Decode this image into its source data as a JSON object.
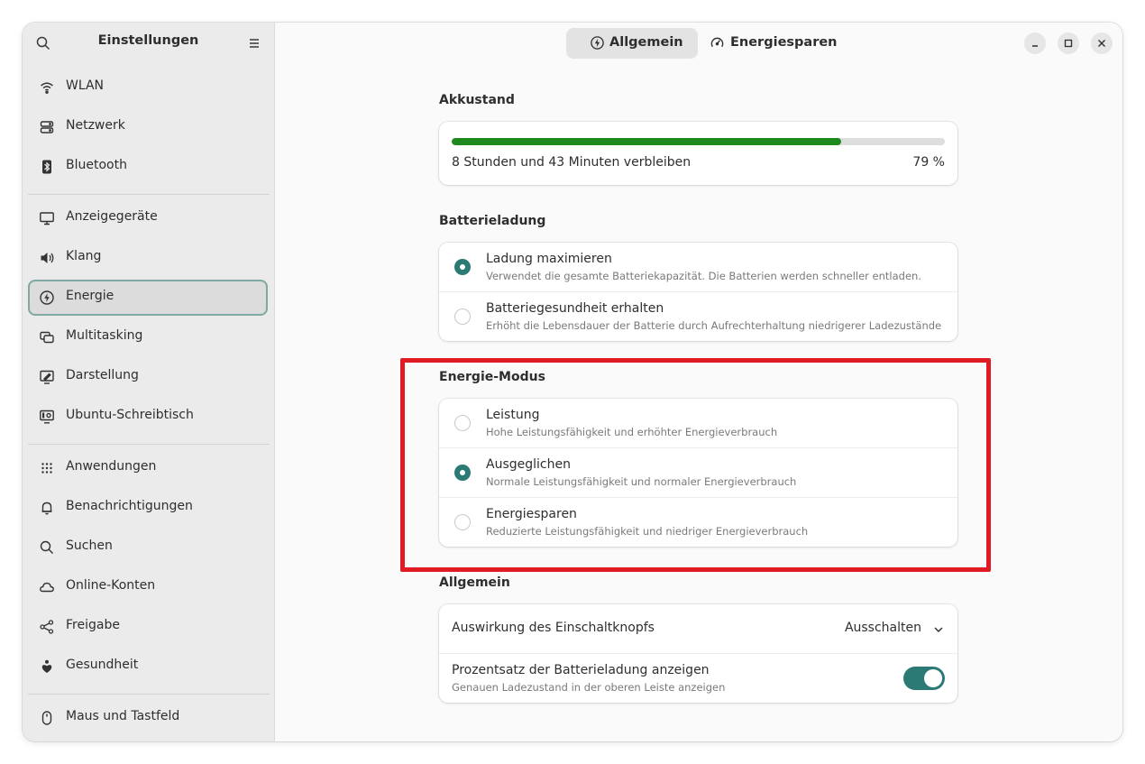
{
  "sidebar": {
    "title": "Einstellungen",
    "items": [
      {
        "label": "WLAN",
        "icon": "wifi-icon"
      },
      {
        "label": "Netzwerk",
        "icon": "network-icon"
      },
      {
        "label": "Bluetooth",
        "icon": "bluetooth-icon"
      },
      {
        "label": "Anzeigegeräte",
        "icon": "display-icon"
      },
      {
        "label": "Klang",
        "icon": "speaker-icon"
      },
      {
        "label": "Energie",
        "icon": "power-icon",
        "selected": true
      },
      {
        "label": "Multitasking",
        "icon": "multitasking-icon"
      },
      {
        "label": "Darstellung",
        "icon": "appearance-icon"
      },
      {
        "label": "Ubuntu-Schreibtisch",
        "icon": "ubuntu-desktop-icon"
      },
      {
        "label": "Anwendungen",
        "icon": "apps-grid-icon"
      },
      {
        "label": "Benachrichtigungen",
        "icon": "bell-icon"
      },
      {
        "label": "Suchen",
        "icon": "search-icon"
      },
      {
        "label": "Online-Konten",
        "icon": "cloud-icon"
      },
      {
        "label": "Freigabe",
        "icon": "share-icon"
      },
      {
        "label": "Gesundheit",
        "icon": "health-icon"
      },
      {
        "label": "Maus und Tastfeld",
        "icon": "mouse-icon"
      }
    ]
  },
  "tabs": [
    {
      "label": "Allgemein",
      "icon": "power-icon",
      "active": true
    },
    {
      "label": "Energiesparen",
      "icon": "gauge-icon",
      "active": false
    }
  ],
  "battery": {
    "section_title": "Akkustand",
    "remaining_text": "8 Stunden und 43 Minuten verbleiben",
    "percent_text": "79 %",
    "level": 0.79
  },
  "charging": {
    "section_title": "Batterieladung",
    "options": [
      {
        "title": "Ladung maximieren",
        "subtitle": "Verwendet die gesamte Batteriekapazität. Die Batterien werden schneller entladen.",
        "selected": true
      },
      {
        "title": "Batteriegesundheit erhalten",
        "subtitle": "Erhöht die Lebensdauer der Batterie durch Aufrechterhaltung niedrigerer Ladezustände",
        "selected": false
      }
    ]
  },
  "power_mode": {
    "section_title": "Energie-Modus",
    "options": [
      {
        "title": "Leistung",
        "subtitle": "Hohe Leistungsfähigkeit und erhöhter Energieverbrauch",
        "selected": false
      },
      {
        "title": "Ausgeglichen",
        "subtitle": "Normale Leistungsfähigkeit und normaler Energieverbrauch",
        "selected": true
      },
      {
        "title": "Energiesparen",
        "subtitle": "Reduzierte Leistungsfähigkeit und niedriger Energieverbrauch",
        "selected": false
      }
    ]
  },
  "general": {
    "section_title": "Allgemein",
    "power_button": {
      "label": "Auswirkung des Einschaltknopfs",
      "value": "Ausschalten"
    },
    "battery_percentage": {
      "label": "Prozentsatz der Batterieladung anzeigen",
      "subtitle": "Genauen Ladezustand in der oberen Leiste anzeigen",
      "enabled": true
    }
  },
  "colors": {
    "accent": "#2b7a75",
    "battery_fill": "#1e8a1e",
    "highlight": "#e01b24"
  }
}
